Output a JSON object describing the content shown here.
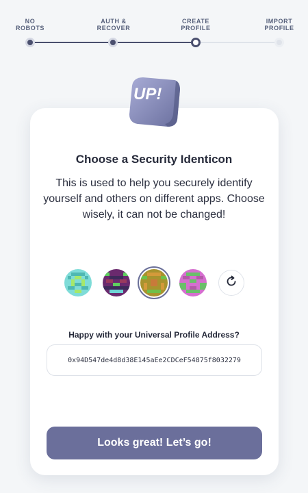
{
  "stepper": {
    "steps": [
      {
        "line1": "NO",
        "line2": "ROBOTS",
        "state": "done"
      },
      {
        "line1": "AUTH &",
        "line2": "RECOVER",
        "state": "done"
      },
      {
        "line1": "CREATE",
        "line2": "PROFILE",
        "state": "current"
      },
      {
        "line1": "IMPORT",
        "line2": "PROFILE",
        "state": "pending"
      }
    ]
  },
  "logo": {
    "text": "UP!"
  },
  "main": {
    "title": "Choose a Security Identicon",
    "subtitle": "This is used to help you securely identify yourself and others on different apps. Choose wisely, it can not be changed!"
  },
  "identicons": {
    "options": [
      "identicon-1",
      "identicon-2",
      "identicon-3",
      "identicon-4"
    ],
    "selected_index": 2,
    "refresh_icon": "refresh-icon"
  },
  "address": {
    "label": "Happy with your Universal Profile Address?",
    "value": "0x94D547de4d8d38E145aEe2CDCeF54875f8032279"
  },
  "cta": {
    "label": "Looks great! Let’s go!"
  },
  "colors": {
    "accent": "#6b6f9b",
    "step_done": "#4a4f6e",
    "step_pending": "#dfe3ea"
  }
}
